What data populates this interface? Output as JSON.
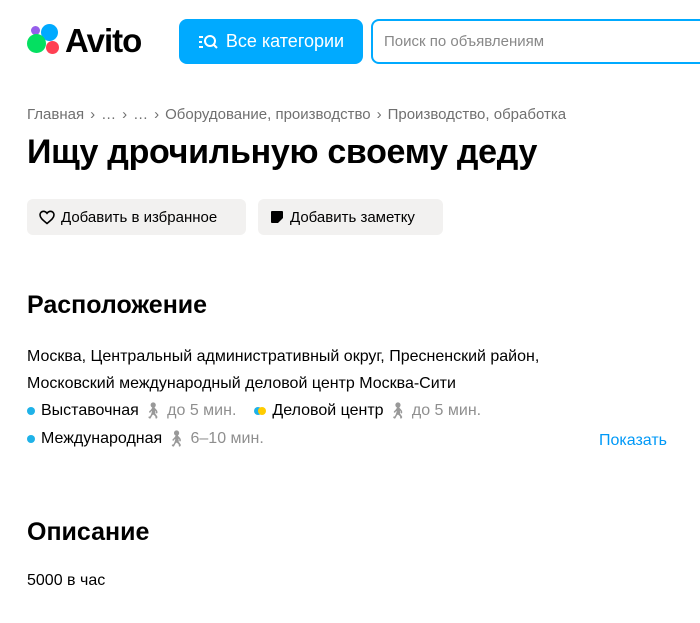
{
  "header": {
    "logo": "Avito",
    "categories_button": "Все категории",
    "search_placeholder": "Поиск по объявлениям"
  },
  "breadcrumb": [
    "Главная",
    "…",
    "…",
    "Оборудование, производство",
    "Производство, обработка"
  ],
  "title": "Ищу дрочильную своему деду",
  "actions": {
    "favorite": "Добавить в избранное",
    "note": "Добавить заметку"
  },
  "location": {
    "heading": "Расположение",
    "address": "Москва, Центральный административный округ, Пресненский район, Московский международный деловой центр Москва-Сити",
    "metro": [
      {
        "name": "Выставочная",
        "time": "до 5 мин.",
        "colors": [
          "#1fb2e8"
        ]
      },
      {
        "name": "Деловой центр",
        "time": "до 5 мин.",
        "colors": [
          "#1fb2e8",
          "#ffcc00"
        ]
      },
      {
        "name": "Международная",
        "time": "6–10 мин.",
        "colors": [
          "#1fb2e8"
        ]
      }
    ],
    "show_map": "Показать"
  },
  "description": {
    "heading": "Описание",
    "text": "5000 в час"
  }
}
